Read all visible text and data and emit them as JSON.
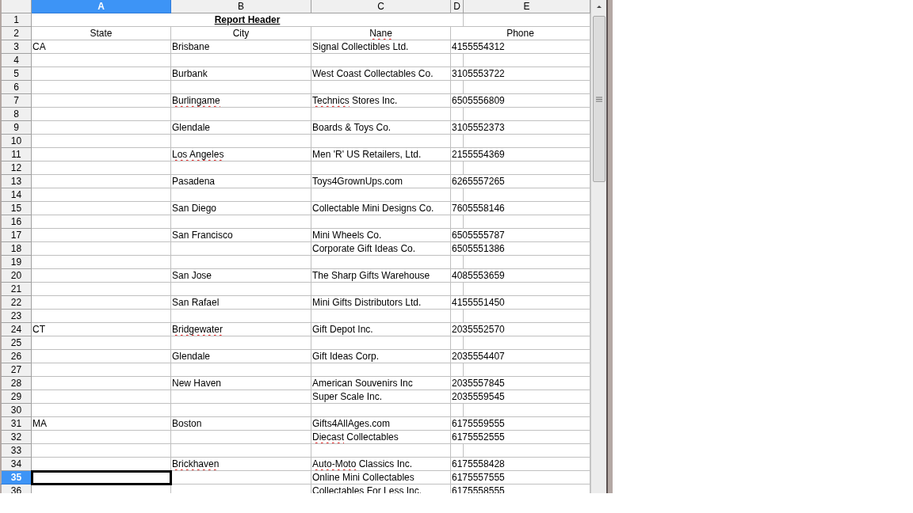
{
  "columns": [
    {
      "label": "A",
      "selected": true
    },
    {
      "label": "B",
      "selected": false
    },
    {
      "label": "C",
      "selected": false
    },
    {
      "label": "D",
      "selected": false
    },
    {
      "label": "E",
      "selected": false
    }
  ],
  "rows": [
    {
      "number": "1",
      "selected": false,
      "kind": "title",
      "title": "Report Header"
    },
    {
      "number": "2",
      "selected": false,
      "kind": "header",
      "state": "State",
      "city": "City",
      "name": [
        {
          "text": "Nane",
          "misspelled": true
        }
      ],
      "phone": "Phone"
    },
    {
      "number": "3",
      "selected": false,
      "state": "CA",
      "city": "Brisbane",
      "name": "Signal Collectibles Ltd.",
      "phone": "4155554312"
    },
    {
      "number": "4",
      "selected": false
    },
    {
      "number": "5",
      "selected": false,
      "city": "Burbank",
      "name": "West Coast Collectables Co.",
      "phone": "3105553722"
    },
    {
      "number": "6",
      "selected": false
    },
    {
      "number": "7",
      "selected": false,
      "city": [
        {
          "text": "Burlingame",
          "misspelled": true
        }
      ],
      "name": [
        {
          "text": "Technics",
          "misspelled": true
        },
        {
          "text": " Stores Inc.",
          "misspelled": false
        }
      ],
      "phone": "6505556809"
    },
    {
      "number": "8",
      "selected": false
    },
    {
      "number": "9",
      "selected": false,
      "city": "Glendale",
      "name": "Boards & Toys Co.",
      "phone": "3105552373"
    },
    {
      "number": "10",
      "selected": false
    },
    {
      "number": "11",
      "selected": false,
      "city": [
        {
          "text": "Los Angeles",
          "misspelled": true
        }
      ],
      "name": "Men 'R' US Retailers, Ltd.",
      "phone": "2155554369"
    },
    {
      "number": "12",
      "selected": false
    },
    {
      "number": "13",
      "selected": false,
      "city": "Pasadena",
      "name": "Toys4GrownUps.com",
      "phone": "6265557265"
    },
    {
      "number": "14",
      "selected": false
    },
    {
      "number": "15",
      "selected": false,
      "city": "San Diego",
      "name": "Collectable Mini Designs Co.",
      "phone": "7605558146"
    },
    {
      "number": "16",
      "selected": false
    },
    {
      "number": "17",
      "selected": false,
      "city": "San Francisco",
      "name": "Mini Wheels Co.",
      "phone": "6505555787"
    },
    {
      "number": "18",
      "selected": false,
      "name": "Corporate Gift Ideas Co.",
      "phone": "6505551386"
    },
    {
      "number": "19",
      "selected": false
    },
    {
      "number": "20",
      "selected": false,
      "city": "San Jose",
      "name": "The Sharp Gifts Warehouse",
      "phone": "4085553659"
    },
    {
      "number": "21",
      "selected": false
    },
    {
      "number": "22",
      "selected": false,
      "city": "San Rafael",
      "name": "Mini Gifts Distributors Ltd.",
      "phone": "4155551450"
    },
    {
      "number": "23",
      "selected": false
    },
    {
      "number": "24",
      "selected": false,
      "state": "CT",
      "city": [
        {
          "text": "Bridgewater",
          "misspelled": true
        }
      ],
      "name": "Gift Depot Inc.",
      "phone": "2035552570"
    },
    {
      "number": "25",
      "selected": false
    },
    {
      "number": "26",
      "selected": false,
      "city": "Glendale",
      "name": "Gift Ideas Corp.",
      "phone": "2035554407"
    },
    {
      "number": "27",
      "selected": false
    },
    {
      "number": "28",
      "selected": false,
      "city": "New Haven",
      "name": "American Souvenirs Inc",
      "phone": "2035557845"
    },
    {
      "number": "29",
      "selected": false,
      "name": "Super Scale Inc.",
      "phone": "2035559545"
    },
    {
      "number": "30",
      "selected": false
    },
    {
      "number": "31",
      "selected": false,
      "state": "MA",
      "city": "Boston",
      "name": "Gifts4AllAges.com",
      "phone": "6175559555"
    },
    {
      "number": "32",
      "selected": false,
      "name": [
        {
          "text": "Diecast",
          "misspelled": true
        },
        {
          "text": " Collectables",
          "misspelled": false
        }
      ],
      "phone": "6175552555"
    },
    {
      "number": "33",
      "selected": false
    },
    {
      "number": "34",
      "selected": false,
      "city": [
        {
          "text": "Brickhaven",
          "misspelled": true
        }
      ],
      "name": [
        {
          "text": "Auto-Moto",
          "misspelled": true
        },
        {
          "text": " Classics Inc.",
          "misspelled": false
        }
      ],
      "phone": "6175558428"
    },
    {
      "number": "35",
      "selected": true,
      "name": "Online Mini Collectables",
      "phone": "6175557555"
    },
    {
      "number": "36",
      "selected": false,
      "name": "Collectables For Less Inc.",
      "phone": "6175558555"
    }
  ]
}
